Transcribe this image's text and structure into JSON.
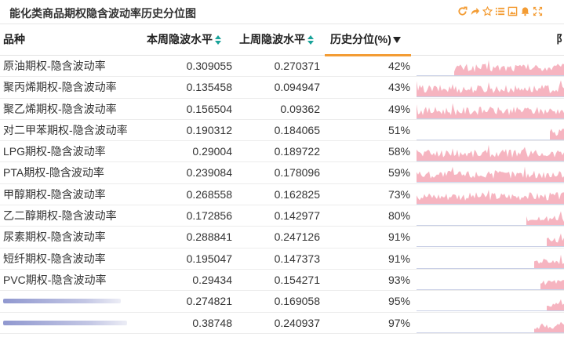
{
  "panel": {
    "title": "能化类商品期权隐含波动率历史分位图",
    "tool_color": "#f39c34",
    "tools": [
      "refresh-icon",
      "share-icon",
      "star-icon",
      "list-icon",
      "image-icon",
      "bell-icon",
      "fullscreen-icon"
    ]
  },
  "table": {
    "columns": [
      {
        "label": "品种",
        "sortable": false
      },
      {
        "label": "本周隐波水平",
        "sortable": true
      },
      {
        "label": "上周隐波水平",
        "sortable": true
      },
      {
        "label": "历史分位(%)",
        "sortable": true,
        "active_sort": "desc"
      }
    ],
    "clipped_column_label": "阝",
    "spark_color": "#f4a7b5",
    "rows": [
      {
        "name": "原油期权-隐含波动率",
        "current": "0.309055",
        "previous": "0.270371",
        "percentile": "42%",
        "spark_level": 0.42
      },
      {
        "name": "聚丙烯期权-隐含波动率",
        "current": "0.135458",
        "previous": "0.094947",
        "percentile": "43%",
        "spark_level": 0.43
      },
      {
        "name": "聚乙烯期权-隐含波动率",
        "current": "0.156504",
        "previous": "0.09362",
        "percentile": "49%",
        "spark_level": 0.49
      },
      {
        "name": "对二甲苯期权-隐含波动率",
        "current": "0.190312",
        "previous": "0.184065",
        "percentile": "51%",
        "spark_level": 0.51
      },
      {
        "name": "LPG期权-隐含波动率",
        "current": "0.29004",
        "previous": "0.189722",
        "percentile": "58%",
        "spark_level": 0.58
      },
      {
        "name": "PTA期权-隐含波动率",
        "current": "0.239084",
        "previous": "0.178096",
        "percentile": "59%",
        "spark_level": 0.59
      },
      {
        "name": "甲醇期权-隐含波动率",
        "current": "0.268558",
        "previous": "0.162825",
        "percentile": "73%",
        "spark_level": 0.73
      },
      {
        "name": "乙二醇期权-隐含波动率",
        "current": "0.172856",
        "previous": "0.142977",
        "percentile": "80%",
        "spark_level": 0.8
      },
      {
        "name": "尿素期权-隐含波动率",
        "current": "0.288841",
        "previous": "0.247126",
        "percentile": "91%",
        "spark_level": 0.91
      },
      {
        "name": "短纤期权-隐含波动率",
        "current": "0.195047",
        "previous": "0.147373",
        "percentile": "91%",
        "spark_level": 0.91
      },
      {
        "name": "PVC期权-隐含波动率",
        "current": "0.29434",
        "previous": "0.154271",
        "percentile": "93%",
        "spark_level": 0.93
      },
      {
        "name": "",
        "current": "0.274821",
        "previous": "0.169058",
        "percentile": "95%",
        "spark_level": 0.95
      },
      {
        "name": "",
        "current": "0.38748",
        "previous": "0.240937",
        "percentile": "97%",
        "spark_level": 0.97
      }
    ]
  }
}
